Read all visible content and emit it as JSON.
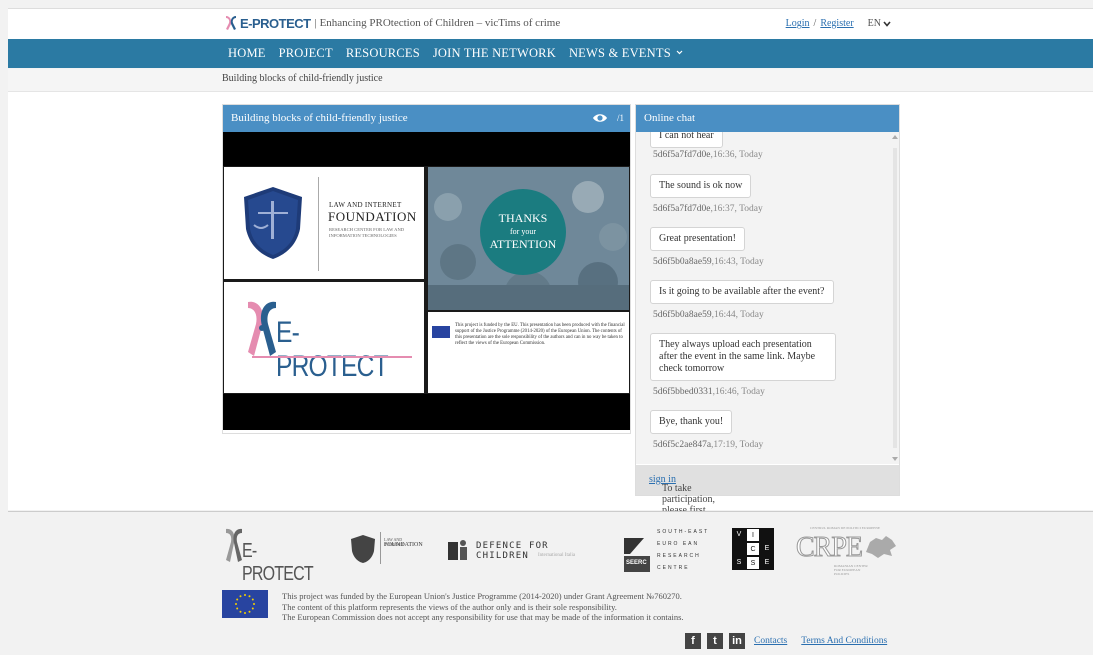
{
  "header": {
    "logo_text": "E-PROTECT",
    "tagline": "| Enhancing PROtection of Children – vicTims of crime",
    "login": "Login",
    "separator": "/",
    "register": "Register",
    "language": "EN"
  },
  "nav": {
    "items": [
      "HOME",
      "PROJECT",
      "RESOURCES",
      "JOIN THE NETWORK",
      "NEWS & EVENTS"
    ]
  },
  "breadcrumb": "Building blocks of child-friendly justice",
  "presentation": {
    "title": "Building blocks of child-friendly justice",
    "count": "/1",
    "law_title_small": "LAW AND INTERNET",
    "law_title_big": "FOUNDATION",
    "law_subtitle": "RESEARCH CENTER FOR LAW AND INFORMATION TECHNOLOGIES",
    "ep_logo": "E-PROTECT",
    "thanks_1": "THANKS",
    "thanks_2": "for your",
    "thanks_3": "ATTENTION",
    "eu_note": "This project is funded by the EU. This presentation has been produced with the financial support of the Justice Programme (2014-2020) of the European Union. The contents of this presentation are the sole responsibility of the authors and can in no way be taken to reflect the views of the European Commission."
  },
  "chat": {
    "title": "Online chat",
    "messages": [
      {
        "text": "I can not hear",
        "user": "5d6f5a7fd7d0e",
        "time": ",16:36, Today"
      },
      {
        "text": "The sound is ok now",
        "user": "5d6f5a7fd7d0e",
        "time": ",16:37, Today"
      },
      {
        "text": "Great presentation!",
        "user": "5d6f5b0a8ae59",
        "time": ",16:43, Today"
      },
      {
        "text": "Is it going to be available after the event?",
        "user": "5d6f5b0a8ae59",
        "time": ",16:44, Today"
      },
      {
        "text": "They always upload each presentation after the event in the same link. Maybe check tomorrow",
        "user": "5d6f5bbed0331",
        "time": ",16:46, Today"
      },
      {
        "text": "Bye, thank you!",
        "user": "5d6f5c2ae847a",
        "time": ",17:19, Today"
      }
    ],
    "footer_text": "To take participation, please first ",
    "footer_link": "sign in"
  },
  "footer": {
    "partners": {
      "eprotect": "E-PROTECT",
      "law_small": "LAW AND INTERNET",
      "law_big": "FOUNDATION",
      "dci": "DEFENCE FOR CHILDREN",
      "dci_sub": "International Italia",
      "seerc_lines": [
        "SOUTH-EAST",
        "EURO EAN",
        "RESEARCH",
        "CENTRE"
      ],
      "seerc_abbr": "SEERC",
      "vicesse": [
        "V",
        "I",
        "",
        "",
        "C",
        "E",
        "S",
        "S",
        "E"
      ],
      "crpe": "CRPE",
      "crpe_top": "CENTRUL ROMAN DE POLITICI EUROPENE",
      "crpe_sub": "ROMANIAN CENTER FOR EUROPEAN POLICIES"
    },
    "funded_lines": [
      "This project was funded by the European Union's Justice Programme (2014-2020) under Grant Agreement №760270.",
      "The content of this platform represents the views of the author only and is their sole responsibility.",
      "The European Commission does not accept any responsibility for use that may be made of the information it contains."
    ],
    "social": [
      "f",
      "t",
      "in"
    ],
    "contacts": "Contacts",
    "terms": "Terms And Conditions"
  },
  "colors": {
    "nav": "#2b7aa3",
    "panel_header": "#4a8fc4",
    "brand": "#2a5f8f",
    "pink": "#e58cb0"
  }
}
